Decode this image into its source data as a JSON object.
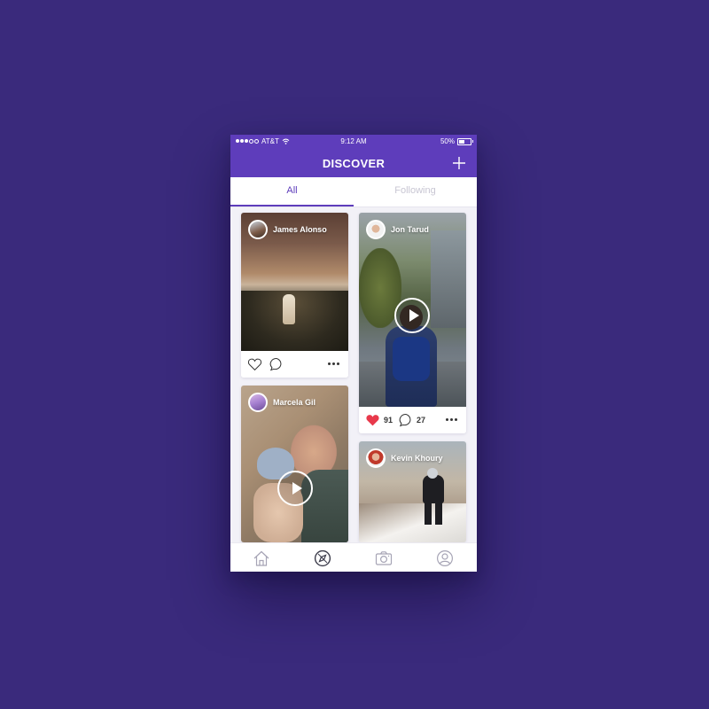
{
  "status_bar": {
    "carrier": "AT&T",
    "time": "9:12 AM",
    "battery": "50%"
  },
  "header": {
    "title": "DISCOVER"
  },
  "tabs": [
    {
      "label": "All",
      "active": true
    },
    {
      "label": "Following",
      "active": false
    }
  ],
  "posts": [
    {
      "author": "James Alonso",
      "media": "photo"
    },
    {
      "author": "Jon Tarud",
      "media": "video",
      "likes": "91",
      "comments": "27",
      "liked": true
    },
    {
      "author": "Marcela Gil",
      "media": "video"
    },
    {
      "author": "Kevin Khoury",
      "media": "photo"
    }
  ],
  "tab_bar": {
    "items": [
      "home-icon",
      "discover-icon",
      "camera-icon",
      "profile-icon"
    ],
    "active": "discover-icon"
  },
  "colors": {
    "accent": "#5e3dbb",
    "background": "#3a2a7c",
    "like": "#e8394b"
  }
}
